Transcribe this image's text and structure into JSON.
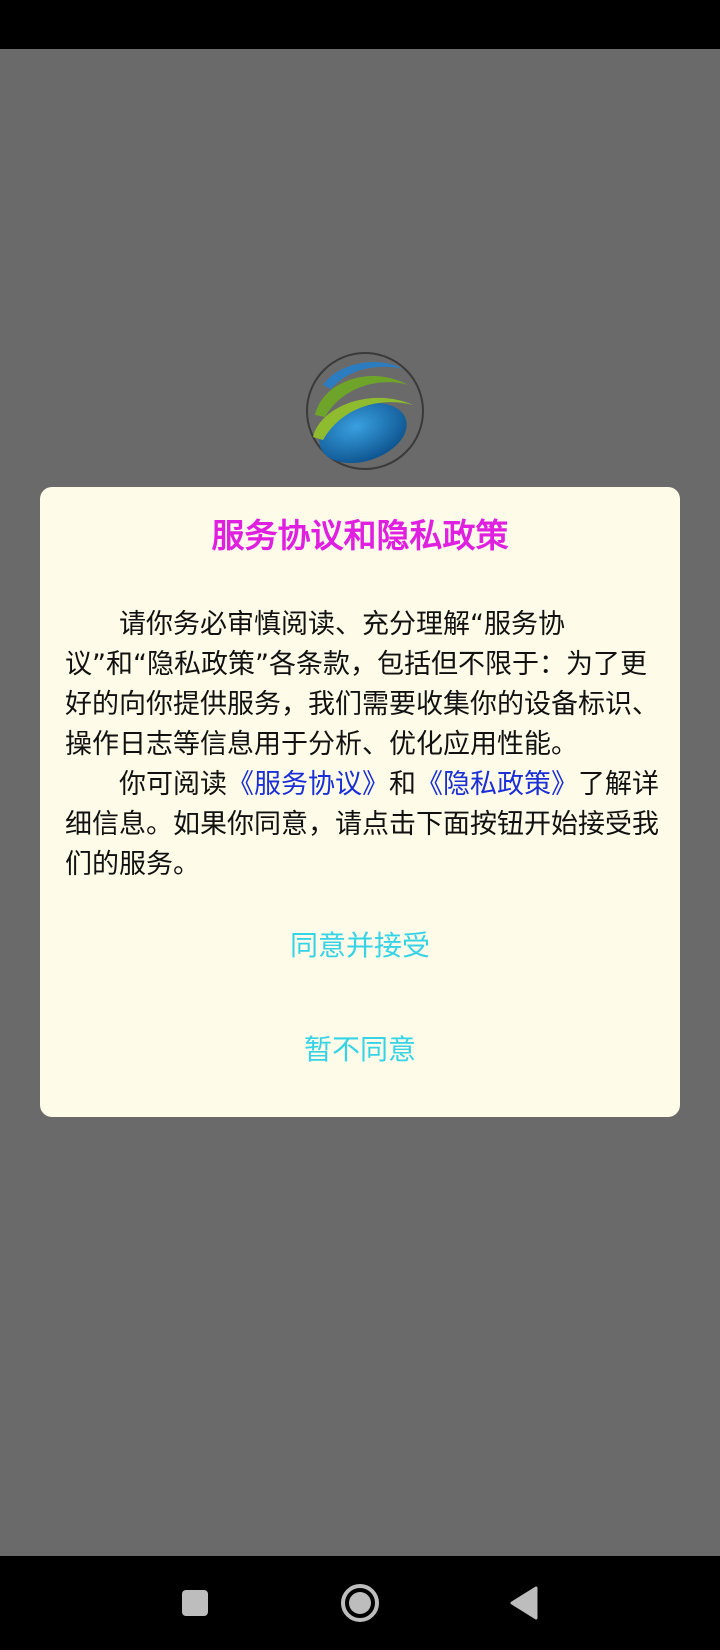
{
  "dialog": {
    "title": "服务协议和隐私政策",
    "para1": "请你务必审慎阅读、充分理解“服务协议”和“隐私政策”各条款，包括但不限于：为了更好的向你提供服务，我们需要收集你的设备标识、操作日志等信息用于分析、优化应用性能。",
    "para2_prefix": "你可阅读",
    "link_service": "《服务协议》",
    "para2_and": "和",
    "link_privacy": "《隐私政策》",
    "para2_suffix": "了解详细信息。如果你同意，请点击下面按钮开始接受我们的服务。",
    "agree_label": "同意并接受",
    "disagree_label": "暂不同意"
  },
  "icons": {
    "logo": "app-logo-icon",
    "recent": "square-icon",
    "home": "circle-icon",
    "back": "triangle-back-icon"
  },
  "colors": {
    "overlay": "#6a6a6a",
    "dialog_bg": "#fefce9",
    "title": "#e020e0",
    "link": "#1a2fd6",
    "button": "#36d3e6"
  }
}
